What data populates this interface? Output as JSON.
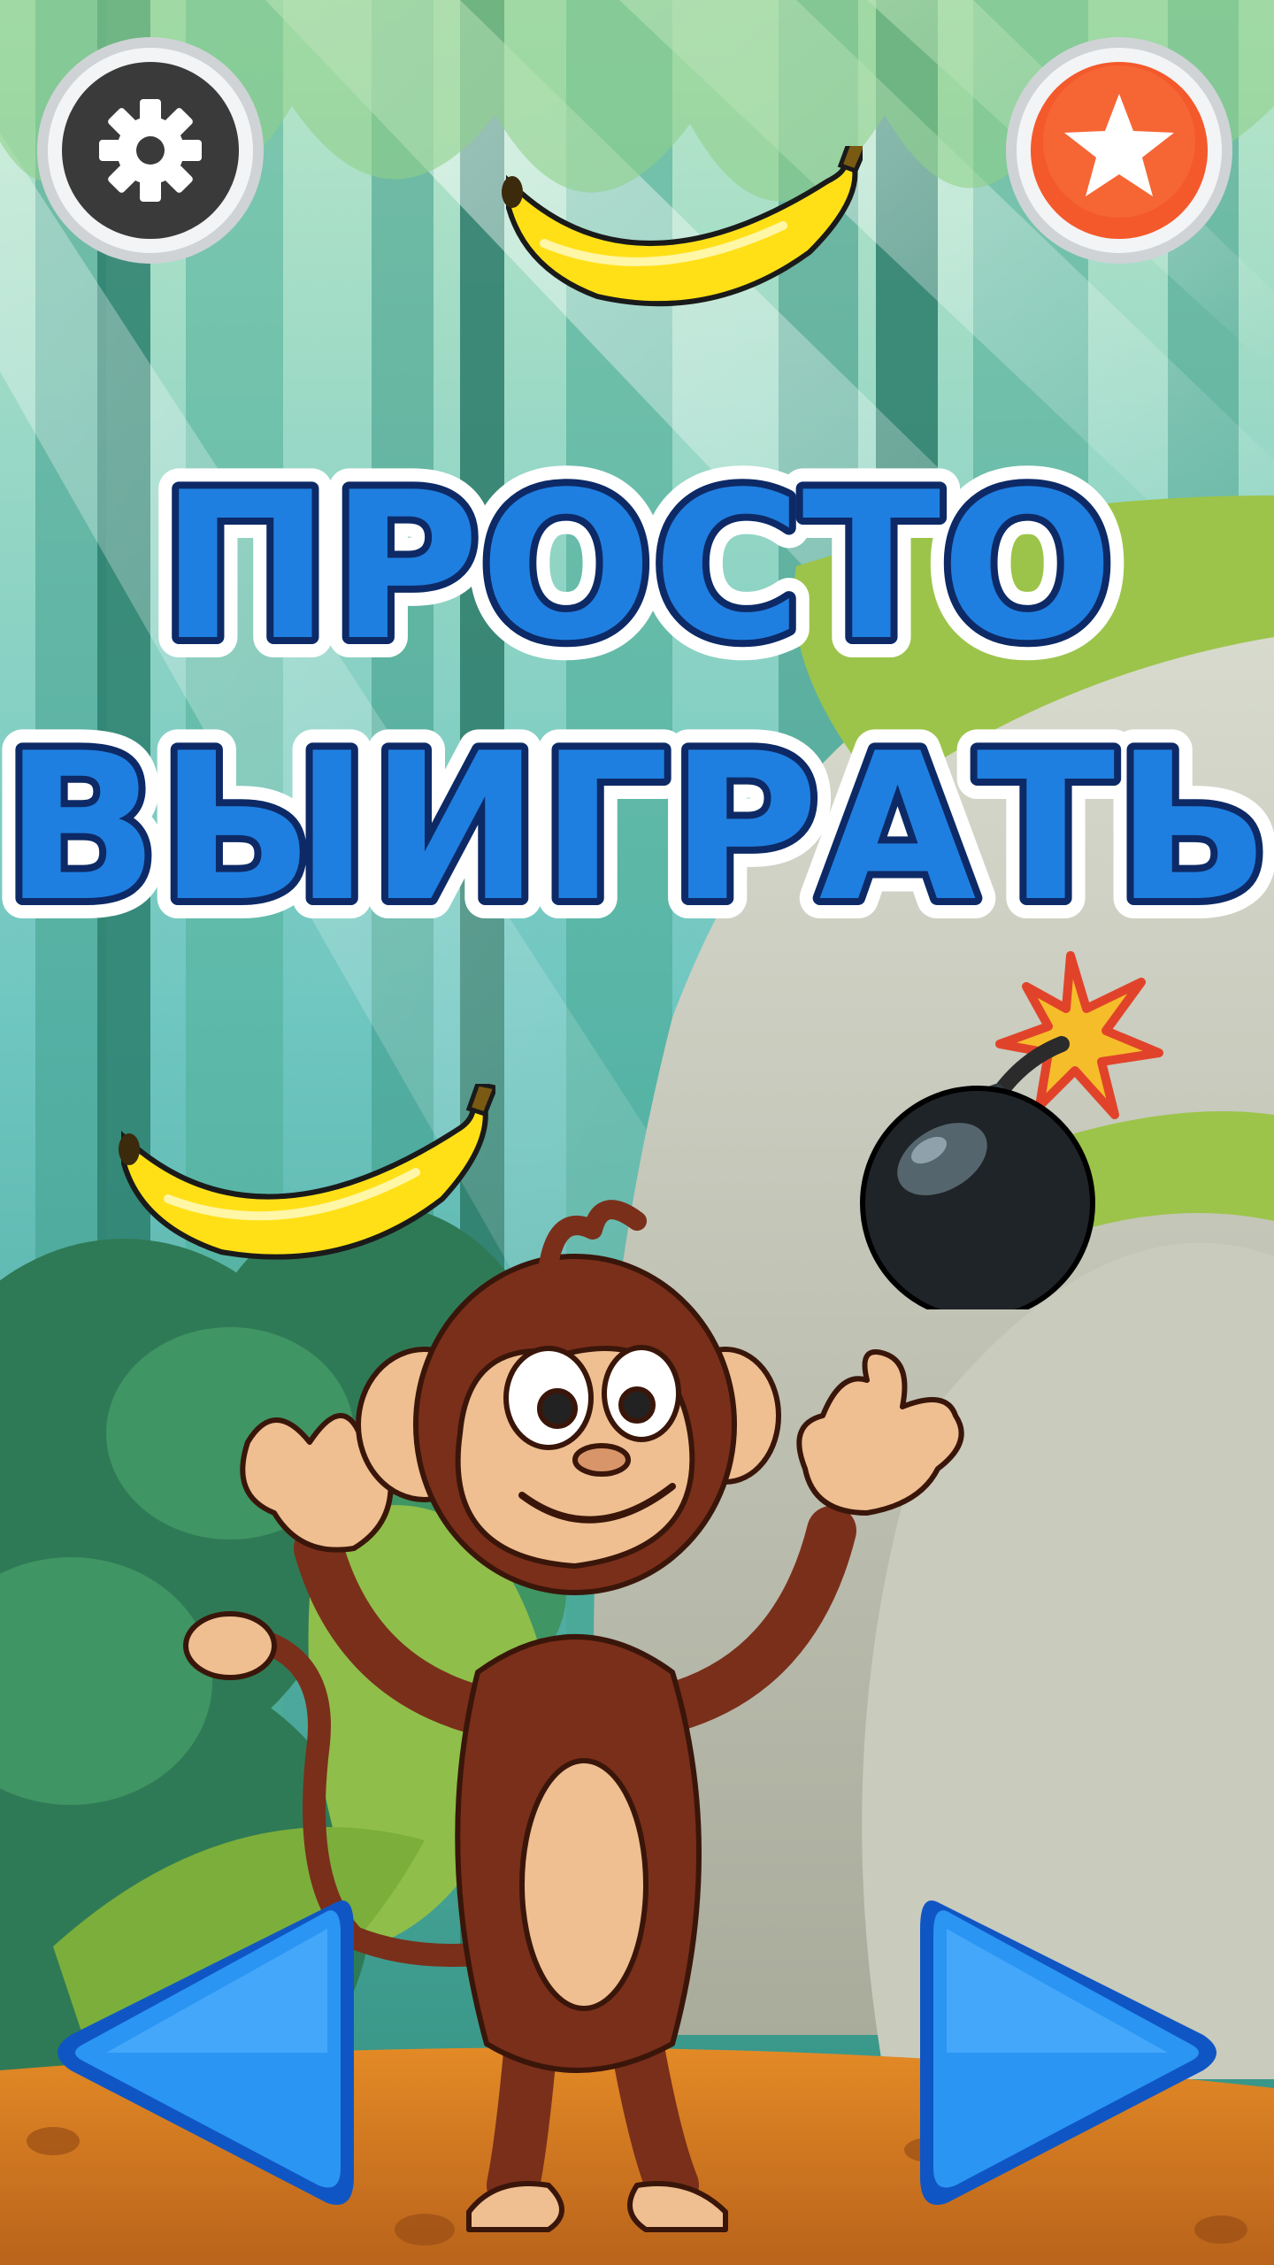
{
  "game": {
    "title_line1": "ПРОСТО",
    "title_line2": "ВЫИГРАТЬ"
  },
  "controls": {
    "settings_icon": "gear-icon",
    "rate_icon": "star-icon",
    "left_icon": "triangle-left-arrow-icon",
    "right_icon": "triangle-right-arrow-icon"
  },
  "colors": {
    "title_fill": "#1f7fe0",
    "title_outline": "#0d2a66",
    "settings_button": "#3a3a3a",
    "rate_button": "#f4592b",
    "arrow_button": "#1e86ef"
  },
  "sprites": [
    "banana",
    "banana",
    "bomb",
    "monkey"
  ]
}
